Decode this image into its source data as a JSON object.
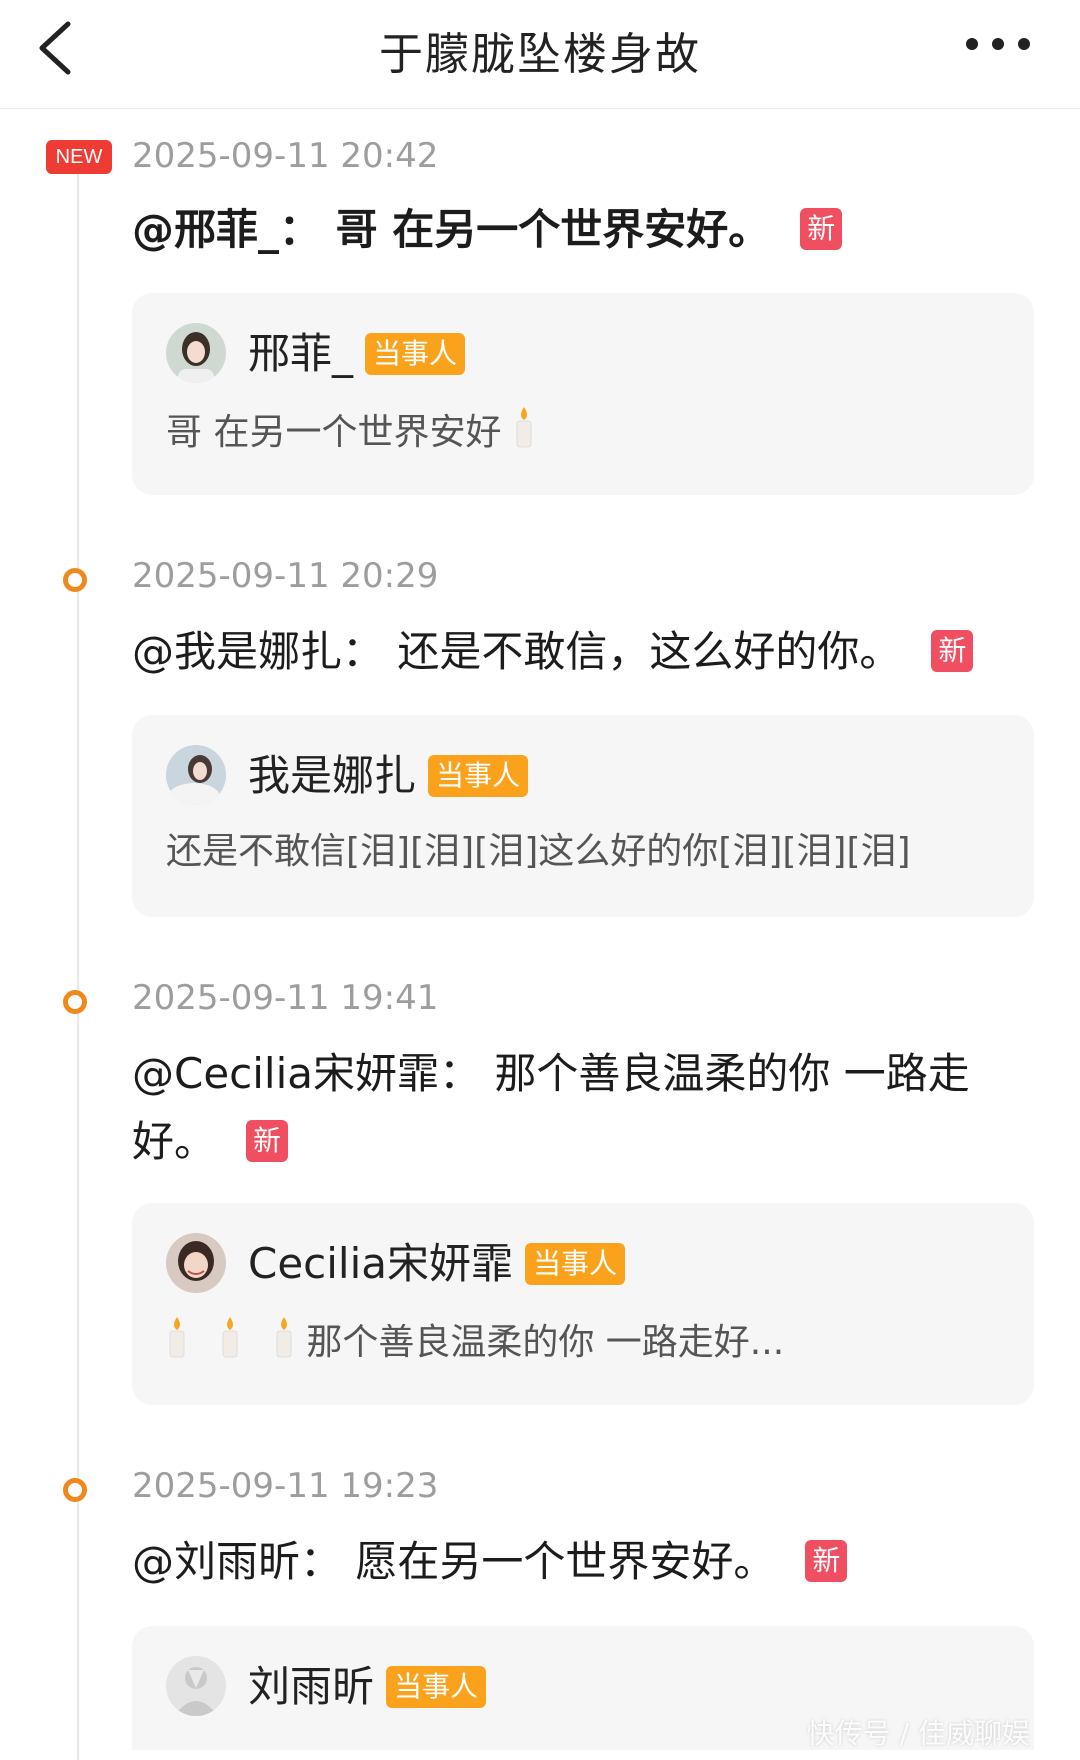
{
  "header": {
    "title": "于朦胧坠楼身故"
  },
  "timeline": {
    "new_label": "NEW",
    "badge_new": "新",
    "role_label": "当事人",
    "items": [
      {
        "time": "2025-09-11 20:42",
        "headline": "@邢菲_： 哥 在另一个世界安好。",
        "author": "邢菲_",
        "text": "哥 在另一个世界安好"
      },
      {
        "time": "2025-09-11 20:29",
        "headline": "@我是娜扎： 还是不敢信，这么好的你。",
        "author": "我是娜扎",
        "text": "还是不敢信[泪][泪][泪]这么好的你[泪][泪][泪]"
      },
      {
        "time": "2025-09-11 19:41",
        "headline": "@Cecilia宋妍霏： 那个善良温柔的你 一路走好。",
        "author": "Cecilia宋妍霏",
        "text": "那个善良温柔的你 一路走好..."
      },
      {
        "time": "2025-09-11 19:23",
        "headline": "@刘雨昕： 愿在另一个世界安好。",
        "author": "刘雨昕",
        "text": ""
      }
    ]
  },
  "watermark": "快传号 / 佳威聊娱",
  "colors": {
    "accent_orange": "#f0891c",
    "new_red": "#ee3b34",
    "badge_pink": "#f04f62",
    "role_orange": "#fba21d"
  },
  "icons": [
    "back-arrow-icon",
    "more-dots-icon",
    "timeline-dot-icon",
    "candle-icon",
    "avatar"
  ]
}
